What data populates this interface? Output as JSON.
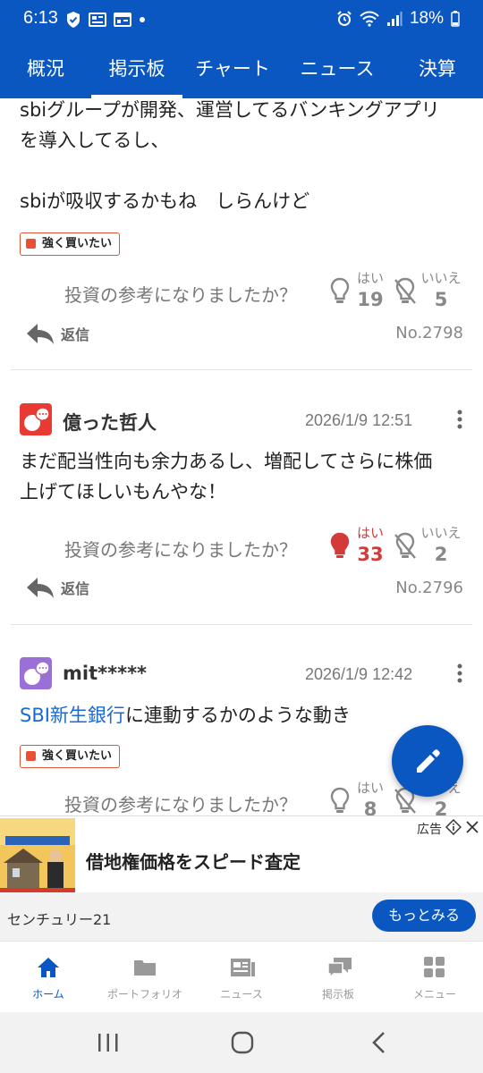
{
  "status_bar": {
    "time": "6:13",
    "battery": "18%"
  },
  "tabs": [
    {
      "label": "概況"
    },
    {
      "label": "掲示板",
      "active": true
    },
    {
      "label": "チャート"
    },
    {
      "label": "ニュース"
    },
    {
      "label": "決算"
    }
  ],
  "posts": [
    {
      "text_lines": [
        "sbiグループが開発、運営してるバンキングアプリ",
        "を導入してるし、",
        "",
        "sbiが吸収するかもね　しらんけど"
      ],
      "sentiment": "強く買いたい",
      "vote_question": "投資の参考になりましたか？",
      "yes_label": "はい",
      "yes_count": "19",
      "no_label": "いいえ",
      "no_count": "5",
      "reply_label": "返信",
      "post_no": "No.2798"
    },
    {
      "author": "億った哲人",
      "date": "2026/1/9 12:51",
      "avatar_color": "#e83a33",
      "text_lines": [
        "まだ配当性向も余力あるし、増配してさらに株価",
        "上げてほしいもんやな！"
      ],
      "vote_question": "投資の参考になりましたか？",
      "yes_label": "はい",
      "yes_count": "33",
      "yes_voted": true,
      "no_label": "いいえ",
      "no_count": "2",
      "reply_label": "返信",
      "post_no": "No.2796"
    },
    {
      "author": "mit*****",
      "date": "2026/1/9 12:42",
      "avatar_color": "#9a6fd6",
      "text_link": "SBI新生銀行",
      "text_rest": "に連動するかのような動き",
      "sentiment": "強く買いたい",
      "vote_question": "投資の参考になりましたか？",
      "yes_label": "はい",
      "yes_count": "8",
      "no_label": "いいえ",
      "no_count": "2"
    }
  ],
  "ad": {
    "headline": "借地権価格をスピード査定",
    "label": "広告",
    "sponsor": "センチュリー21",
    "cta": "もっとみる"
  },
  "bottom_nav": [
    {
      "label": "ホーム",
      "icon": "home-icon",
      "active": true
    },
    {
      "label": "ポートフォリオ",
      "icon": "folder-icon"
    },
    {
      "label": "ニュース",
      "icon": "newspaper-icon"
    },
    {
      "label": "掲示板",
      "icon": "chat-bubbles-icon"
    },
    {
      "label": "メニュー",
      "icon": "grid-menu-icon"
    }
  ],
  "colors": {
    "brand": "#0a57c2",
    "vote_active": "#d33a3a",
    "sentiment": "#ee4d35",
    "link": "#1a6ad4"
  }
}
